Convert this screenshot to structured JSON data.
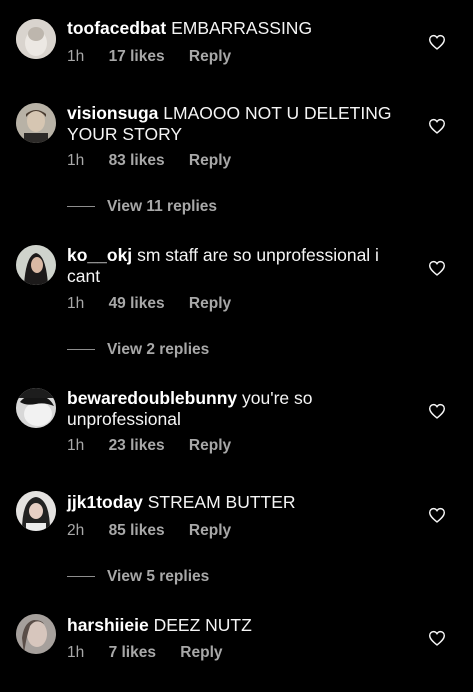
{
  "comments": [
    {
      "username": "toofacedbat",
      "text": "EMBARRASSING",
      "time": "1h",
      "likes": "17 likes",
      "reply_label": "Reply",
      "avatar_icon": "avatar-icon",
      "heart_icon": "heart-outline-icon"
    },
    {
      "username": "visionsuga",
      "text": "LMAOOO NOT U DELETING YOUR STORY",
      "time": "1h",
      "likes": "83 likes",
      "reply_label": "Reply",
      "view_replies": "View 11 replies",
      "avatar_icon": "avatar-icon",
      "heart_icon": "heart-outline-icon"
    },
    {
      "username": "ko__okj",
      "text": "sm staff are so unprofessional i cant",
      "time": "1h",
      "likes": "49 likes",
      "reply_label": "Reply",
      "view_replies": "View 2 replies",
      "avatar_icon": "avatar-icon",
      "heart_icon": "heart-outline-icon"
    },
    {
      "username": "bewaredoublebunny",
      "text": "you're so unprofessional",
      "time": "1h",
      "likes": "23 likes",
      "reply_label": "Reply",
      "avatar_icon": "avatar-icon",
      "heart_icon": "heart-outline-icon"
    },
    {
      "username": "jjk1today",
      "text": "STREAM BUTTER",
      "time": "2h",
      "likes": "85 likes",
      "reply_label": "Reply",
      "view_replies": "View 5 replies",
      "avatar_icon": "avatar-icon",
      "heart_icon": "heart-outline-icon"
    },
    {
      "username": "harshiieie",
      "text": "DEEZ NUTZ",
      "time": "1h",
      "likes": "7 likes",
      "reply_label": "Reply",
      "avatar_icon": "avatar-icon",
      "heart_icon": "heart-outline-icon"
    }
  ],
  "colors": {
    "background": "#000000",
    "text": "#f5f5f5",
    "secondary_text": "#a8a8a8"
  }
}
